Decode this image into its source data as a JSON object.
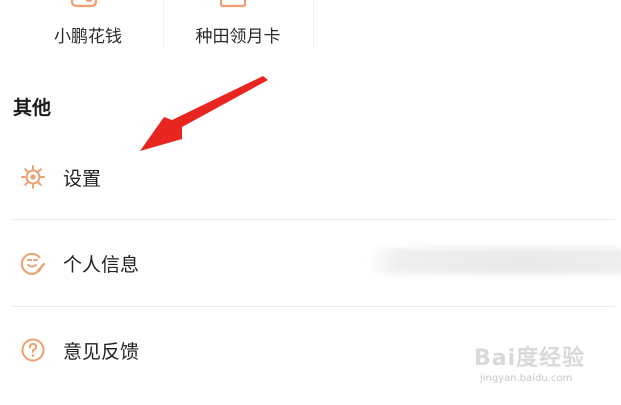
{
  "top_grid": {
    "items": [
      {
        "label": "小鹏花钱",
        "icon": "wallet-icon"
      },
      {
        "label": "种田领月卡",
        "icon": "card-icon"
      }
    ]
  },
  "section": {
    "title": "其他"
  },
  "menu": {
    "items": [
      {
        "label": "设置",
        "icon": "gear-icon"
      },
      {
        "label": "个人信息",
        "icon": "profile-edit-icon"
      },
      {
        "label": "意见反馈",
        "icon": "question-icon"
      }
    ]
  },
  "colors": {
    "accent": "#f0a070",
    "arrow": "#e8251f",
    "text": "#222222",
    "divider": "#ececec"
  },
  "watermark": {
    "brand": "Bai度经验",
    "url": "jingyan.baidu.com"
  }
}
